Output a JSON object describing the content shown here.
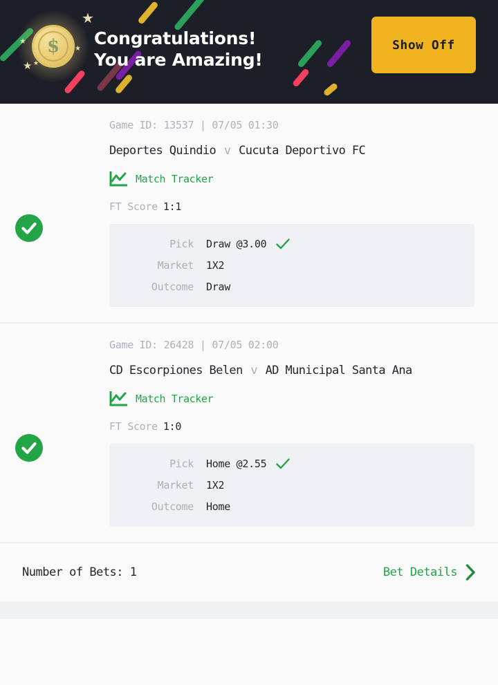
{
  "banner": {
    "title_line1": "Congratulations!",
    "title_line2": "You are Amazing!",
    "button_label": "Show Off",
    "coin_symbol": "$",
    "background_color": "#1d1f28",
    "button_color": "#f0b421",
    "title_color": "#ffffff"
  },
  "bets": [
    {
      "status": "won",
      "game_id_line": "Game ID: 13537 | 07/05 01:30",
      "home_team": "Deportes Quindio",
      "vs": "v",
      "away_team": "Cucuta Deportivo FC",
      "tracker_label": "Match Tracker",
      "ft_score_label": "FT Score",
      "ft_score_value": "1:1",
      "pick_label": "Pick",
      "pick_value": "Draw @3.00",
      "market_label": "Market",
      "market_value": "1X2",
      "outcome_label": "Outcome",
      "outcome_value": "Draw"
    },
    {
      "status": "won",
      "game_id_line": "Game ID: 26428 | 07/05 02:00",
      "home_team": "CD Escorpiones Belen",
      "vs": "v",
      "away_team": "AD Municipal Santa Ana",
      "tracker_label": "Match Tracker",
      "ft_score_label": "FT Score",
      "ft_score_value": "1:0",
      "pick_label": "Pick",
      "pick_value": "Home @2.55",
      "market_label": "Market",
      "market_value": "1X2",
      "outcome_label": "Outcome",
      "outcome_value": "Home"
    }
  ],
  "footer": {
    "bets_count_label": "Number of Bets: 1",
    "bet_details_label": "Bet Details"
  },
  "colors": {
    "green": "#22a447",
    "gold": "#f0b421",
    "muted": "#aab0b8",
    "dark_text": "#23262c"
  }
}
